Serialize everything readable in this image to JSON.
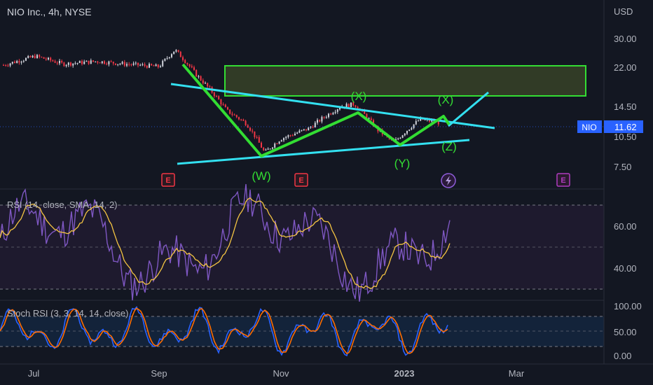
{
  "title": "NIO Inc., 4h, NYSE",
  "currency": "USD",
  "price_badge": {
    "symbol": "NIO",
    "value": "11.62"
  },
  "rsi_label": "RSI (14, close, SMA, 14, 2)",
  "stoch_label": "Stoch RSI (3, 3, 14, 14, close)",
  "colors": {
    "background": "#131722",
    "candles_up": "#d1d4dc",
    "candles_down": "#f23645",
    "wave_green": "#33dd33",
    "trendline_cyan": "#33e0f0",
    "zone_border": "#33dd33",
    "zone_fill": "#4a5a2a",
    "rsi_line": "#7e57c2",
    "rsi_ma": "#f5c542",
    "stoch_k": "#2962ff",
    "stoch_d": "#ff6d00",
    "earnings_red": "#f23645",
    "earnings_purple": "#b03cc0"
  },
  "chart_data": [
    {
      "type": "line",
      "pane": "price",
      "x_axis_ticks": [
        "Jul",
        "Sep",
        "Nov",
        "2023",
        "Mar"
      ],
      "y_axis_ticks": [
        "30.00",
        "22.00",
        "14.50",
        "10.50",
        "7.50"
      ],
      "y_scale": "log",
      "ylim": [
        6.5,
        35
      ],
      "approx_close": [
        {
          "x": "2022-06-15",
          "y": 19.8
        },
        {
          "x": "2022-07-01",
          "y": 21.5
        },
        {
          "x": "2022-07-15",
          "y": 20.0
        },
        {
          "x": "2022-08-01",
          "y": 20.5
        },
        {
          "x": "2022-08-15",
          "y": 20.0
        },
        {
          "x": "2022-09-01",
          "y": 19.5
        },
        {
          "x": "2022-09-09",
          "y": 22.8
        },
        {
          "x": "2022-09-20",
          "y": 18.0
        },
        {
          "x": "2022-10-05",
          "y": 13.0
        },
        {
          "x": "2022-10-15",
          "y": 11.5
        },
        {
          "x": "2022-10-24",
          "y": 8.8
        },
        {
          "x": "2022-11-01",
          "y": 10.0
        },
        {
          "x": "2022-11-15",
          "y": 11.0
        },
        {
          "x": "2022-12-01",
          "y": 13.5
        },
        {
          "x": "2022-12-08",
          "y": 13.8
        },
        {
          "x": "2022-12-20",
          "y": 10.8
        },
        {
          "x": "2022-12-28",
          "y": 9.7
        },
        {
          "x": "2023-01-10",
          "y": 12.0
        },
        {
          "x": "2023-01-20",
          "y": 11.6
        }
      ],
      "wave_labels": [
        "(W)",
        "(X)",
        "(Y)",
        "(X)",
        "(Z)"
      ],
      "resistance_zone": {
        "from": "2022-09-25",
        "to": "2023-03-20",
        "low": 16.8,
        "high": 22.0
      }
    },
    {
      "type": "line",
      "pane": "rsi",
      "name": "RSI (14, close, SMA, 14, 2)",
      "y_axis_ticks": [
        "60.00",
        "40.00"
      ],
      "ylim": [
        25,
        75
      ],
      "bands": [
        70,
        50,
        30
      ]
    },
    {
      "type": "line",
      "pane": "stoch_rsi",
      "name": "Stoch RSI (3, 3, 14, 14, close)",
      "y_axis_ticks": [
        "100.00",
        "50.00",
        "0.00"
      ],
      "ylim": [
        0,
        100
      ],
      "bands": [
        80,
        50,
        20
      ]
    }
  ]
}
